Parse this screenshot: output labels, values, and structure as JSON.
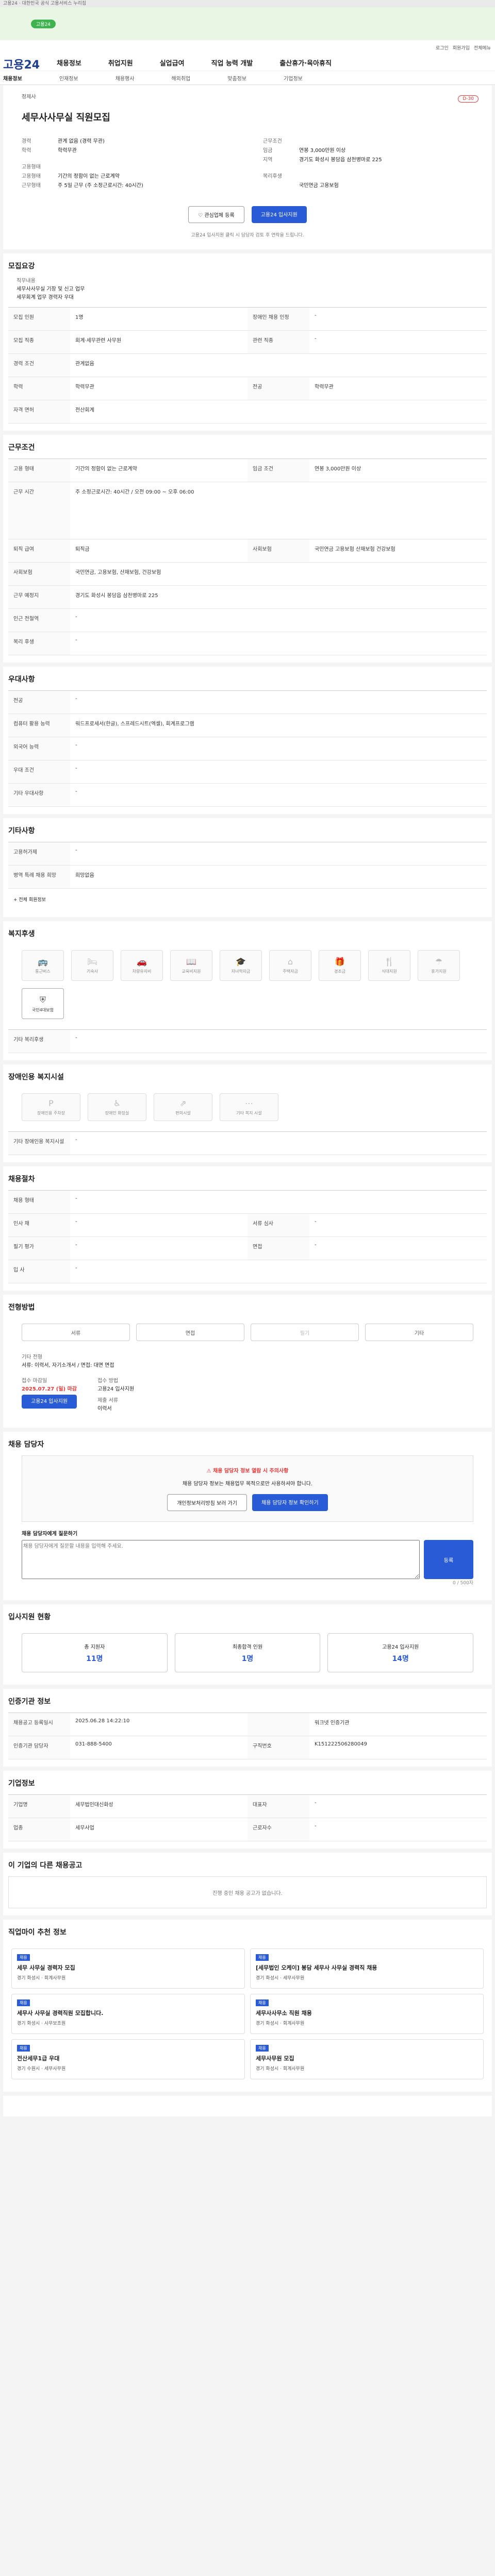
{
  "topbar": {
    "text": "고용24 · 대한민국 공식 고용서비스 누리집"
  },
  "banner": {
    "pill": "고용24"
  },
  "header": {
    "logo": "고용24",
    "gnb": [
      "채용정보",
      "취업지원",
      "실업급여",
      "직업 능력 개발",
      "출산휴가·육아휴직"
    ],
    "util": [
      "로그인",
      "회원가입",
      "전체메뉴"
    ],
    "sub": [
      "채용정보",
      "인재정보",
      "채용행사",
      "해외취업",
      "맞춤정보",
      "기업정보"
    ]
  },
  "job": {
    "badge": "D-30",
    "title": "세무사사무실 직원모집",
    "company_label": "회사명",
    "company": "정제사",
    "left": [
      {
        "k": "경력",
        "v": "관계 없음 (경력 무관)"
      },
      {
        "k": "학력",
        "v": "학력무관"
      }
    ],
    "right_title": "근무조건",
    "right": [
      {
        "k": "임금",
        "v": "연봉 3,000만원 이상"
      },
      {
        "k": "지역",
        "v": "경기도 화성시 봉담읍 삼천병마로 225"
      }
    ],
    "left2_title": "고용형태",
    "left2": [
      {
        "k": "고용형태",
        "v": "기간의 정함이 없는 근로계약"
      },
      {
        "k": "근무형태",
        "v": "주 5일 근무 (주 소정근로시간: 40시간)"
      }
    ],
    "right2_title": "복리후생",
    "right2": [
      {
        "k": "",
        "v": "국민연금 고용보험"
      }
    ],
    "scrap": "관심업체 등록",
    "apply": "고용24 입사지원",
    "note": "고용24 입사지원 클릭 시 담당자 검토 후 연락을 드립니다."
  },
  "recruit": {
    "title": "모집요강",
    "job_label": "직무내용",
    "job_desc": [
      "세무사사무실 기장 및 신고 업무",
      "세무회계 업무 경력자 우대"
    ],
    "rows": [
      [
        {
          "k": "모집 인원",
          "v": "1명"
        },
        {
          "k": "장애인 채용 인정",
          "v": "-"
        }
      ],
      [
        {
          "k": "모집 직종",
          "v": "회계·세무관련 사무원"
        },
        {
          "k": "관련 직종",
          "v": "-"
        }
      ],
      [
        {
          "k": "경력 조건",
          "v": "관계없음"
        },
        {
          "k": "",
          "v": ""
        }
      ],
      [
        {
          "k": "학력",
          "v": "학력무관"
        },
        {
          "k": "전공",
          "v": "학력무관"
        }
      ],
      [
        {
          "k": "자격 면허",
          "v": "전산회계"
        },
        {
          "k": "",
          "v": ""
        }
      ]
    ]
  },
  "conditions": {
    "title": "근무조건",
    "rows": [
      [
        {
          "k": "고용 형태",
          "v": "기간의 정함이 없는 근로계약"
        },
        {
          "k": "임금 조건",
          "v": "연봉 3,000만원 이상"
        }
      ],
      [
        {
          "k": "근무 시간",
          "v": "주 소정근로시간: 40시간 / 오전 09:00 ~ 오후 06:00"
        },
        {
          "k": "",
          "v": ""
        }
      ],
      [
        {
          "k": "퇴직 급여",
          "v": "퇴직금"
        },
        {
          "k": "사회보험",
          "v": "국민연금 고용보험 산재보험 건강보험"
        }
      ],
      [
        {
          "k": "사회보험",
          "v": "국민연금, 고용보험, 산재보험, 건강보험"
        },
        {
          "k": "",
          "v": ""
        }
      ],
      [
        {
          "k": "근무 예정지",
          "v": "경기도 화성시 봉담읍 삼천병마로 225"
        },
        {
          "k": "",
          "v": ""
        }
      ],
      [
        {
          "k": "인근 전철역",
          "v": "-"
        },
        {
          "k": "",
          "v": ""
        }
      ],
      [
        {
          "k": "복리 후생",
          "v": "-"
        },
        {
          "k": "",
          "v": ""
        }
      ]
    ]
  },
  "preferred": {
    "title": "우대사항",
    "rows": [
      {
        "k": "전공",
        "v": "-"
      },
      {
        "k": "컴퓨터 활용 능력",
        "v": "워드프로세서(한글), 스프레드시트(엑셀), 회계프로그램"
      },
      {
        "k": "외국어 능력",
        "v": "-"
      },
      {
        "k": "우대 조건",
        "v": "-"
      },
      {
        "k": "기타 우대사항",
        "v": "-"
      }
    ]
  },
  "other": {
    "title": "기타사항",
    "rows": [
      {
        "k": "고용허가제",
        "v": "-"
      },
      {
        "k": "병역 특례 채용 희망",
        "v": "희망없음"
      }
    ],
    "more": "+ 전체 회원정보"
  },
  "welfare": {
    "title": "복지후생",
    "items": [
      "통근버스",
      "기숙사",
      "차량유지비",
      "교육비지원",
      "자녀학자금",
      "주택자금",
      "경조금",
      "식대지원",
      "휴가지원",
      "국민4대보험"
    ],
    "etc_title": "기타 복리후생",
    "etc": "-"
  },
  "disabled": {
    "title": "장애인용 복지시설",
    "items": [
      "장애인용 주차장",
      "장애인 화장실",
      "편의시설",
      "기타 복지 시설"
    ],
    "etc_title": "기타 장애인용 복지시설",
    "etc": "-"
  },
  "process": {
    "title": "채용절차",
    "rows": [
      [
        {
          "k": "채용 형태",
          "v": "-"
        },
        {
          "k": "",
          "v": ""
        }
      ],
      [
        {
          "k": "인사 채",
          "v": "-"
        },
        {
          "k": "서류 심사",
          "v": "-"
        }
      ],
      [
        {
          "k": "필기 평가",
          "v": "-"
        },
        {
          "k": "면접",
          "v": "-"
        }
      ],
      [
        {
          "k": "입 사",
          "v": "-"
        },
        {
          "k": "",
          "v": ""
        }
      ]
    ]
  },
  "apply": {
    "title": "전형방법",
    "methods": [
      "서류",
      "면접",
      "필기",
      "기타"
    ],
    "etc_title": "기타 전형",
    "etc": "서류: 이력서, 자기소개서 / 면접: 대면 면접",
    "deadline_label": "접수 마감일",
    "deadline": "2025.07.27 (일) 마감",
    "apply_method_label": "접수 방법",
    "apply_method": "고용24 입사지원",
    "docs_label": "제출 서류",
    "docs": "이력서",
    "apply_btn": "고용24 입사지원"
  },
  "contact": {
    "title": "채용 담당자",
    "warn": "채용 담당자 정보 열람 시 주의사항",
    "desc": "채용 담당자 정보는 채용업무 목적으로만 사용하셔야 합니다.",
    "btn1": "개인정보처리방침 보러 가기",
    "btn2": "채용 담당자 정보 확인하기"
  },
  "inquiry": {
    "title": "채용 담당자에게 질문하기",
    "placeholder": "채용 담당자에게 질문할 내용을 입력해 주세요.",
    "count": "0 / 500자",
    "send": "등록"
  },
  "stats": {
    "title": "입사지원 현황",
    "items": [
      {
        "label": "총 지원자",
        "value": "11명"
      },
      {
        "label": "최종합격 인원",
        "value": "1명"
      },
      {
        "label": "고용24 입사지원",
        "value": "14명"
      }
    ]
  },
  "info": {
    "title": "인증기관 정보",
    "rows": [
      [
        {
          "k": "채용공고 등록일시",
          "v": "2025.06.28 14:22:10"
        },
        {
          "k": "",
          "v": "워크넷 인증기관"
        }
      ],
      [
        {
          "k": "인증기관 담당자",
          "v": "031-888-5400"
        },
        {
          "k": "구직번호",
          "v": "K151222506280049"
        }
      ]
    ]
  },
  "company": {
    "title": "기업정보",
    "rows": [
      {
        "k": "기업명",
        "v": "세무법인대신화성"
      },
      {
        "k": "업종",
        "v": "세무사업"
      },
      {
        "k": "대표자",
        "v": "-"
      },
      {
        "k": "근로자수",
        "v": "-"
      }
    ]
  },
  "more_jobs": {
    "title": "이 기업의 다른 채용공고",
    "empty": "진행 중인 채용 공고가 없습니다."
  },
  "recommend": {
    "title": "직업마이 추천 정보",
    "cards": [
      {
        "tag": "채용",
        "title": "세무 사무실 경력자 모집",
        "meta": "경기 화성시 · 회계사무원"
      },
      {
        "tag": "채용",
        "title": "[세무법인 오케이] 봉담 세무사 사무실 경력직 채용",
        "meta": "경기 화성시 · 세무사무원"
      },
      {
        "tag": "채용",
        "title": "세무사 사무실 경력직원 모집합니다.",
        "meta": "경기 화성시 · 사무보조원"
      },
      {
        "tag": "채용",
        "title": "세무사사무소 직원 채용",
        "meta": "경기 화성시 · 회계사무원"
      },
      {
        "tag": "채용",
        "title": "전산세무1급 우대",
        "meta": "경기 수원시 · 세무사무원"
      },
      {
        "tag": "채용",
        "title": "세무사무원 모집",
        "meta": "경기 화성시 · 회계사무원"
      }
    ]
  }
}
